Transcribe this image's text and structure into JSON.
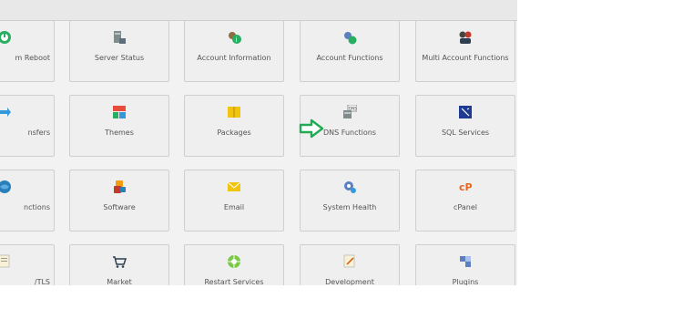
{
  "tiles": [
    {
      "label": "m Reboot"
    },
    {
      "label": "Server Status"
    },
    {
      "label": "Account Information"
    },
    {
      "label": "Account Functions"
    },
    {
      "label": "Multi Account Functions"
    },
    {
      "label": "nsfers"
    },
    {
      "label": "Themes"
    },
    {
      "label": "Packages"
    },
    {
      "label": "DNS Functions"
    },
    {
      "label": "SQL Services"
    },
    {
      "label": "nctions"
    },
    {
      "label": "Software"
    },
    {
      "label": "Email"
    },
    {
      "label": "System Health"
    },
    {
      "label": "cPanel"
    },
    {
      "label": "/TLS"
    },
    {
      "label": "Market"
    },
    {
      "label": "Restart Services"
    },
    {
      "label": "Development"
    },
    {
      "label": "Plugins"
    }
  ],
  "colors": {
    "arrow": "#22aa55",
    "tile_bg": "#efefef",
    "tile_border": "#cfcfcf",
    "text": "#555555"
  }
}
